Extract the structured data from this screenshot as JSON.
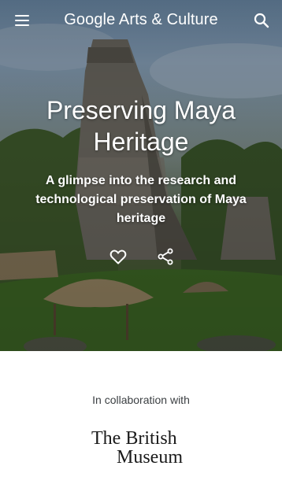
{
  "header": {
    "brand": "Google Arts & Culture",
    "menu_icon": "hamburger-menu-icon",
    "search_icon": "search-icon"
  },
  "hero": {
    "title": "Preserving Maya Heritage",
    "subtitle": "A glimpse into the research and technological preservation of Maya heritage",
    "actions": {
      "like_icon": "heart-outline-icon",
      "share_icon": "share-icon"
    }
  },
  "collaboration": {
    "label": "In collaboration with",
    "partner_logo": {
      "line1": "The British",
      "line2": "Museum"
    }
  },
  "colors": {
    "text_light": "#ffffff",
    "text_dark": "#3c4043",
    "logo": "#1a1a1a"
  }
}
